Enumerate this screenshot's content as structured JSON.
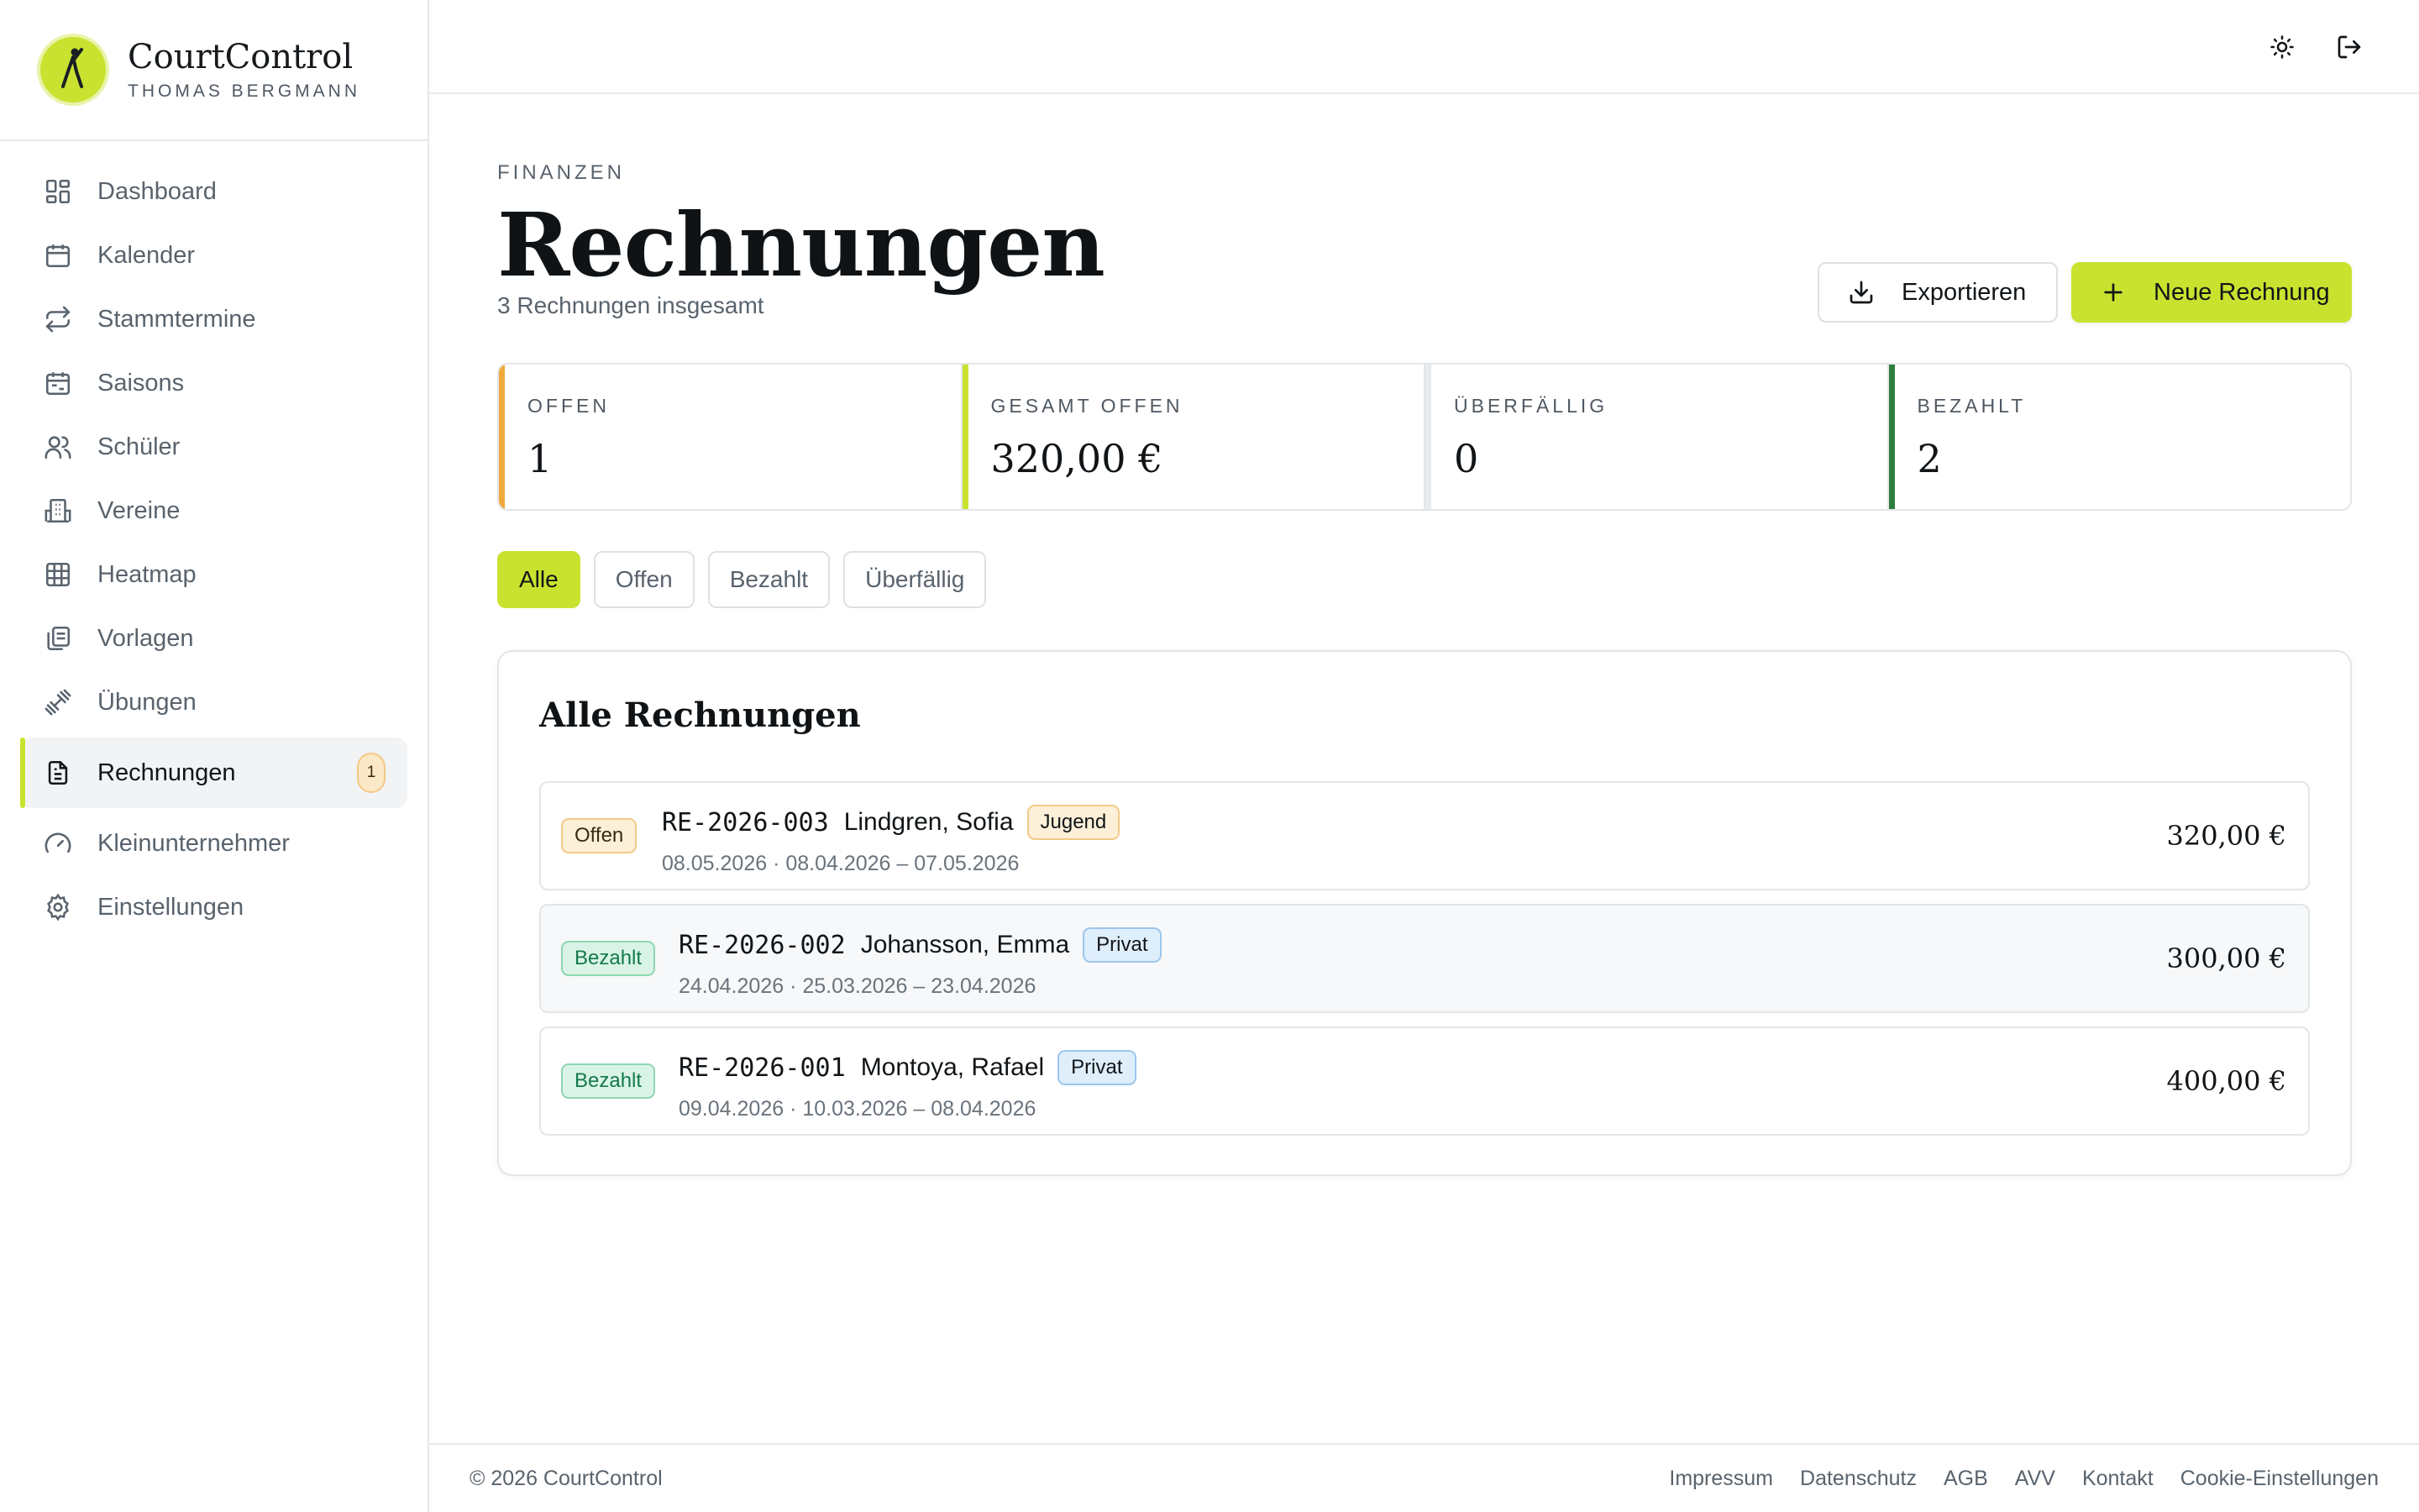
{
  "brand": {
    "name": "CourtControl",
    "user": "THOMAS BERGMANN",
    "accent": "#c9e22f"
  },
  "sidebar": {
    "items": [
      {
        "label": "Dashboard",
        "icon": "dashboard-icon"
      },
      {
        "label": "Kalender",
        "icon": "calendar-icon"
      },
      {
        "label": "Stammtermine",
        "icon": "repeat-icon"
      },
      {
        "label": "Saisons",
        "icon": "calendar-range-icon"
      },
      {
        "label": "Schüler",
        "icon": "users-icon"
      },
      {
        "label": "Vereine",
        "icon": "building-icon"
      },
      {
        "label": "Heatmap",
        "icon": "grid-icon"
      },
      {
        "label": "Vorlagen",
        "icon": "copy-icon"
      },
      {
        "label": "Übungen",
        "icon": "dumbbell-icon"
      },
      {
        "label": "Rechnungen",
        "icon": "document-icon",
        "active": true,
        "badge": "1"
      },
      {
        "label": "Kleinunternehmer",
        "icon": "gauge-icon"
      },
      {
        "label": "Einstellungen",
        "icon": "gear-icon"
      }
    ]
  },
  "topbar": {
    "icons": [
      "sun-icon",
      "logout-icon"
    ]
  },
  "header": {
    "eyebrow": "FINANZEN",
    "title": "Rechnungen",
    "subtitle": "3 Rechnungen insgesamt",
    "export_label": "Exportieren",
    "new_label": "Neue Rechnung"
  },
  "stats": [
    {
      "label": "OFFEN",
      "value": "1",
      "color": "#f2a93b"
    },
    {
      "label": "GESAMT OFFEN",
      "value": "320,00 €",
      "color": "#c9e22f"
    },
    {
      "label": "ÜBERFÄLLIG",
      "value": "0",
      "color": "#e8ecef"
    },
    {
      "label": "BEZAHLT",
      "value": "2",
      "color": "#2e7d3c"
    }
  ],
  "filters": [
    {
      "label": "Alle",
      "active": true
    },
    {
      "label": "Offen"
    },
    {
      "label": "Bezahlt"
    },
    {
      "label": "Überfällig"
    }
  ],
  "invoices": {
    "title": "Alle Rechnungen",
    "rows": [
      {
        "status": "Offen",
        "number": "RE-2026-003",
        "client": "Lindgren, Sofia",
        "tag": "Jugend",
        "dates": "08.05.2026 · 08.04.2026 – 07.05.2026",
        "amount": "320,00 €"
      },
      {
        "status": "Bezahlt",
        "number": "RE-2026-002",
        "client": "Johansson, Emma",
        "tag": "Privat",
        "dates": "24.04.2026 · 25.03.2026 – 23.04.2026",
        "amount": "300,00 €"
      },
      {
        "status": "Bezahlt",
        "number": "RE-2026-001",
        "client": "Montoya, Rafael",
        "tag": "Privat",
        "dates": "09.04.2026 · 10.03.2026 – 08.04.2026",
        "amount": "400,00 €"
      }
    ]
  },
  "footer": {
    "copyright": "© 2026 CourtControl",
    "links": [
      "Impressum",
      "Datenschutz",
      "AGB",
      "AVV",
      "Kontakt",
      "Cookie-Einstellungen"
    ]
  }
}
